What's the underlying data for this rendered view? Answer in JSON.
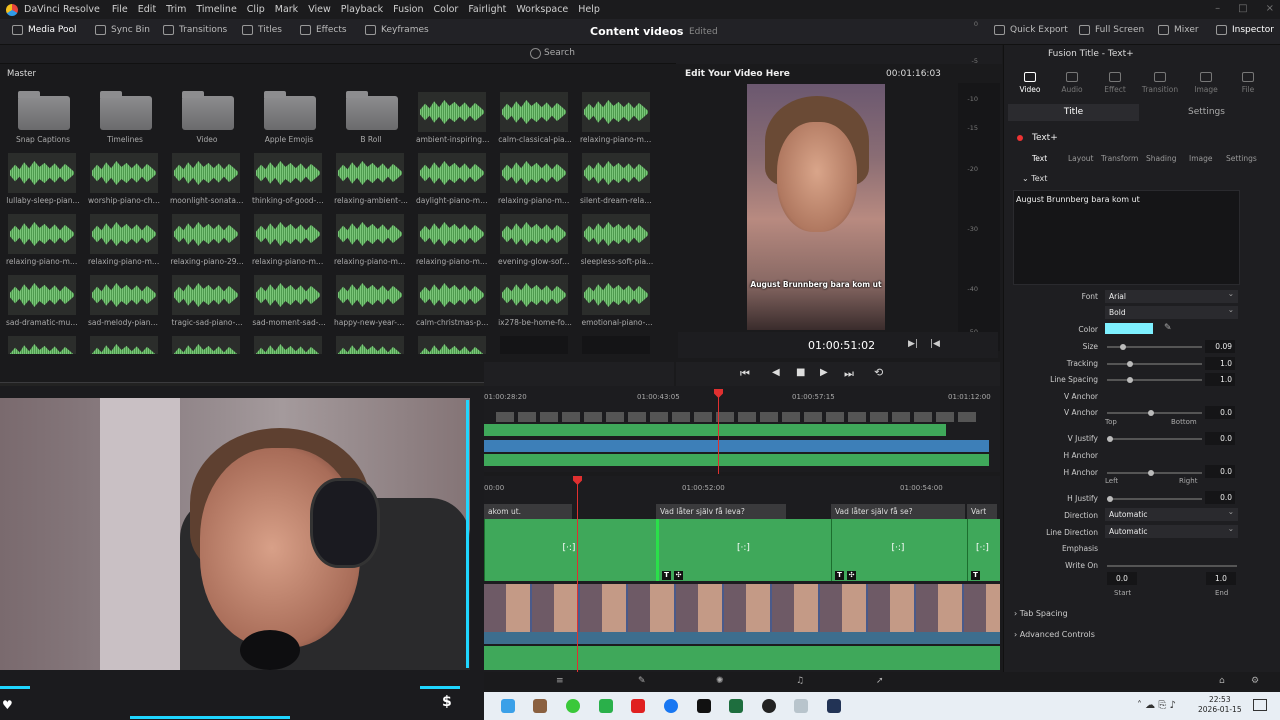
{
  "app": {
    "title": "DaVinci Resolve"
  },
  "menu": [
    "File",
    "Edit",
    "Trim",
    "Timeline",
    "Clip",
    "Mark",
    "View",
    "Playback",
    "Fusion",
    "Color",
    "Fairlight",
    "Workspace",
    "Help"
  ],
  "toolbar": {
    "media_pool": "Media Pool",
    "sync_bin": "Sync Bin",
    "transitions": "Transitions",
    "titles": "Titles",
    "effects": "Effects",
    "keyframes": "Keyframes",
    "quick_export": "Quick Export",
    "full_screen": "Full Screen",
    "mixer": "Mixer",
    "inspector": "Inspector"
  },
  "project": {
    "title": "Content videos",
    "status": "Edited"
  },
  "media_pool": {
    "search_placeholder": "Search",
    "bin": "Master",
    "clips": [
      {
        "label": "Snap Captions",
        "type": "folder"
      },
      {
        "label": "Timelines",
        "type": "folder"
      },
      {
        "label": "Video",
        "type": "folder"
      },
      {
        "label": "Apple Emojis",
        "type": "folder"
      },
      {
        "label": "B Roll",
        "type": "folder"
      },
      {
        "label": "ambient-inspiring-...",
        "type": "audio"
      },
      {
        "label": "calm-classical-pia...",
        "type": "audio"
      },
      {
        "label": "relaxing-piano-mu...",
        "type": "audio"
      },
      {
        "label": "lullaby-sleep-pian...",
        "type": "audio"
      },
      {
        "label": "worship-piano-chr...",
        "type": "audio"
      },
      {
        "label": "moonlight-sonata-...",
        "type": "audio"
      },
      {
        "label": "thinking-of-good-t...",
        "type": "audio"
      },
      {
        "label": "relaxing-ambient-...",
        "type": "audio"
      },
      {
        "label": "daylight-piano-mu...",
        "type": "audio"
      },
      {
        "label": "relaxing-piano-mu...",
        "type": "audio"
      },
      {
        "label": "silent-dream-relax...",
        "type": "audio"
      },
      {
        "label": "relaxing-piano-mu...",
        "type": "audio"
      },
      {
        "label": "relaxing-piano-mu...",
        "type": "audio"
      },
      {
        "label": "relaxing-piano-29...",
        "type": "audio"
      },
      {
        "label": "relaxing-piano-mu...",
        "type": "audio"
      },
      {
        "label": "relaxing-piano-mu...",
        "type": "audio"
      },
      {
        "label": "relaxing-piano-mu...",
        "type": "audio"
      },
      {
        "label": "evening-glow-soft-...",
        "type": "audio"
      },
      {
        "label": "sleepless-soft-pia...",
        "type": "audio"
      },
      {
        "label": "sad-dramatic-mus...",
        "type": "audio"
      },
      {
        "label": "sad-melody-piano...",
        "type": "audio"
      },
      {
        "label": "tragic-sad-piano-...",
        "type": "audio"
      },
      {
        "label": "sad-moment-sad-...",
        "type": "audio"
      },
      {
        "label": "happy-new-year-p...",
        "type": "audio"
      },
      {
        "label": "calm-christmas-pi...",
        "type": "audio"
      },
      {
        "label": "ix278-be-home-fo...",
        "type": "audio"
      },
      {
        "label": "emotional-piano-...",
        "type": "audio"
      }
    ]
  },
  "viewer": {
    "title": "Edit Your Video Here",
    "timecode_top": "00:01:16:03",
    "timecode": "01:00:51:02",
    "subtitle": "August Brunnberg bara kom ut",
    "meter_ticks": [
      "0",
      "-5",
      "-10",
      "-15",
      "-20",
      "-30",
      "-40",
      "-50"
    ]
  },
  "inspector": {
    "title": "Fusion Title - Text+",
    "tabs": [
      "Video",
      "Audio",
      "Effect",
      "Transition",
      "Image",
      "File"
    ],
    "top_tabs": {
      "title": "Title",
      "settings": "Settings"
    },
    "node": "Text+",
    "sub_tabs": [
      "Text",
      "Layout",
      "Transform",
      "Shading",
      "Image",
      "Settings"
    ],
    "section_text": "Text",
    "text_value": "August Brunnberg bara kom ut",
    "font": {
      "label": "Font",
      "value": "Arial"
    },
    "style": "Bold",
    "color": {
      "label": "Color",
      "value": "#7ef0ff"
    },
    "size": {
      "label": "Size",
      "value": "0.09",
      "fraction": 0.15
    },
    "tracking": {
      "label": "Tracking",
      "value": "1.0",
      "fraction": 0.22
    },
    "line_spacing": {
      "label": "Line Spacing",
      "value": "1.0",
      "fraction": 0.22
    },
    "v_anchor": "V Anchor",
    "v_anchor2": {
      "label": "V Anchor",
      "value": "0.0",
      "fraction": 0.46
    },
    "v_top": "Top",
    "v_bottom": "Bottom",
    "v_justify": {
      "label": "V Justify",
      "value": "0.0",
      "fraction": 0.0
    },
    "h_anchor": "H Anchor",
    "h_anchor2": {
      "label": "H Anchor",
      "value": "0.0",
      "fraction": 0.46
    },
    "h_left": "Left",
    "h_right": "Right",
    "h_justify": {
      "label": "H Justify",
      "value": "0.0",
      "fraction": 0.0
    },
    "direction": {
      "label": "Direction",
      "value": "Automatic"
    },
    "line_direction": {
      "label": "Line Direction",
      "value": "Automatic"
    },
    "emphasis": "Emphasis",
    "write_on": {
      "label": "Write On",
      "start": "0.0",
      "end": "1.0",
      "start_label": "Start",
      "end_label": "End"
    },
    "tab_spacing": "Tab Spacing",
    "advanced": "Advanced Controls"
  },
  "timeline": {
    "top_tcs": [
      "01:00:28:20",
      "01:00:43:05",
      "01:00:57:15",
      "01:01:12:00"
    ],
    "bottom_tcs": [
      "00:00",
      "01:00:52:00",
      "01:00:54:00"
    ],
    "subtitles": [
      "akom ut.",
      "Vad låter själv få leva?",
      "Vad låter själv få se?",
      "Vart"
    ]
  },
  "taskbar": {
    "time": "22:53",
    "date": "2026-01-15"
  }
}
